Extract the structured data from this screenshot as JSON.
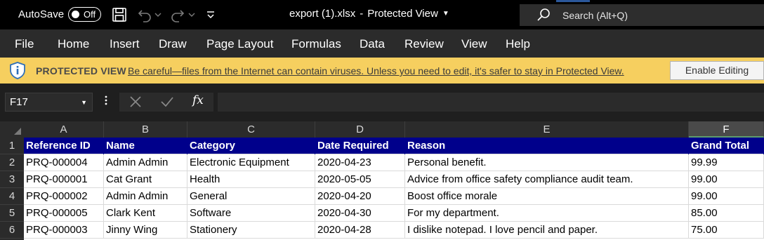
{
  "titlebar": {
    "autosave_label": "AutoSave",
    "autosave_state": "Off",
    "icons": [
      "save-icon",
      "undo-icon",
      "redo-icon",
      "customize-qat-icon"
    ],
    "document_name": "export (1).xlsx",
    "separator": "-",
    "view_mode": "Protected View",
    "search_placeholder": "Search (Alt+Q)"
  },
  "menu": {
    "items": [
      "File",
      "Home",
      "Insert",
      "Draw",
      "Page Layout",
      "Formulas",
      "Data",
      "Review",
      "View",
      "Help"
    ]
  },
  "protected_view": {
    "title": "PROTECTED VIEW",
    "message": "Be careful—files from the Internet can contain viruses. Unless you need to edit, it's safer to stay in Protected View.",
    "enable_button": "Enable Editing"
  },
  "formula_bar": {
    "name_box": "F17",
    "fx_label": "fx",
    "formula": ""
  },
  "sheet": {
    "columns": [
      "A",
      "B",
      "C",
      "D",
      "E",
      "F"
    ],
    "selected_column": "F",
    "row_numbers": [
      "1",
      "2",
      "3",
      "4",
      "5",
      "6"
    ],
    "header_fill_color": "#00008b",
    "header": [
      "Reference ID",
      "Name",
      "Category",
      "Date Required",
      "Reason",
      "Grand Total"
    ],
    "rows": [
      [
        "PRQ-000004",
        "Admin Admin",
        "Electronic Equipment",
        "2020-04-23",
        "Personal benefit.",
        "99.99"
      ],
      [
        "PRQ-000001",
        "Cat Grant",
        "Health",
        "2020-05-05",
        "Advice from office safety compliance audit team.",
        "99.00"
      ],
      [
        "PRQ-000002",
        "Admin Admin",
        "General",
        "2020-04-20",
        "Boost office morale",
        "99.00"
      ],
      [
        "PRQ-000005",
        "Clark Kent",
        "Software",
        "2020-04-30",
        "For my department.",
        "85.00"
      ],
      [
        "PRQ-000003",
        "Jinny Wing",
        "Stationery",
        "2020-04-28",
        "I dislike notepad. I love pencil and paper.",
        "75.00"
      ]
    ]
  }
}
